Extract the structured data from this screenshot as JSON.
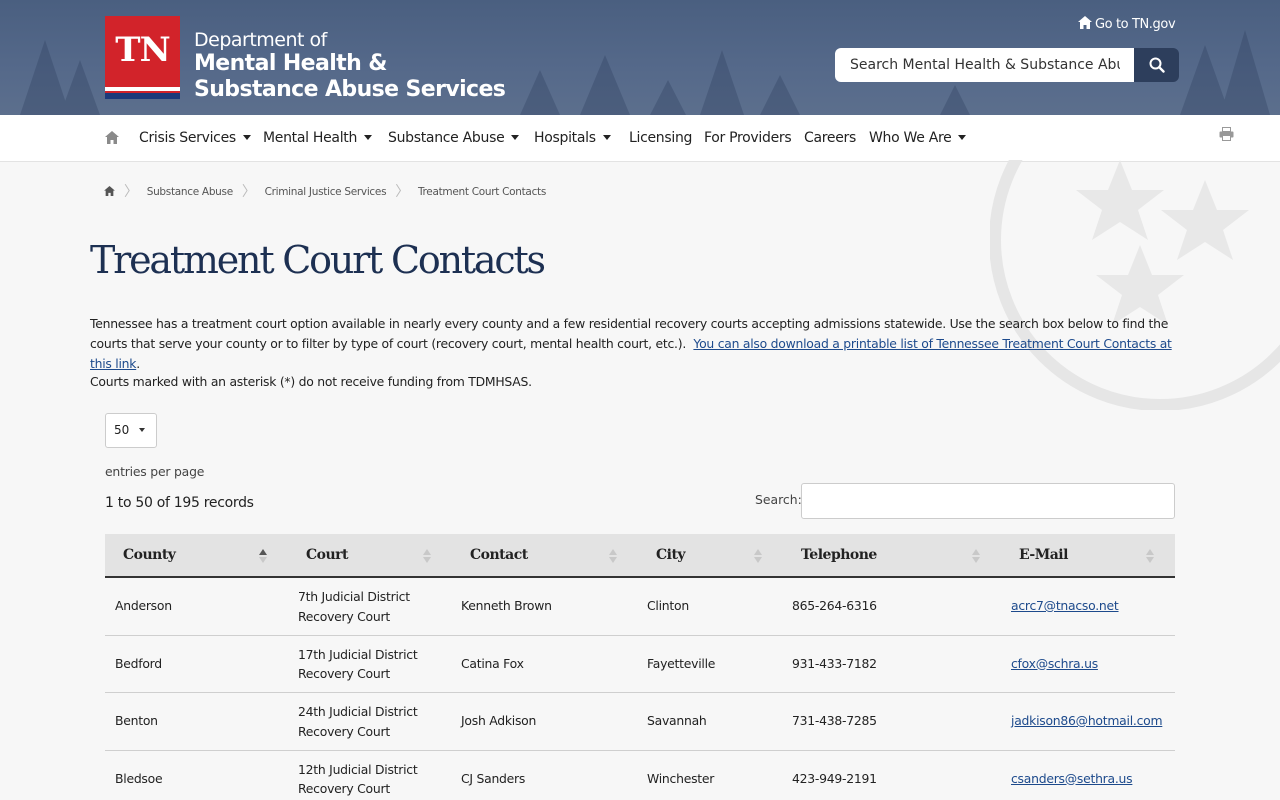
{
  "header": {
    "logo_text": "TN",
    "dept_line1": "Department of",
    "dept_line2": "Mental Health &",
    "dept_line3": "Substance Abuse Services",
    "goto_link": "Go to TN.gov",
    "search_placeholder": "Search Mental Health & Substance Abuse Services"
  },
  "nav": {
    "items": [
      {
        "label": "Crisis Services",
        "dropdown": true
      },
      {
        "label": "Mental Health",
        "dropdown": true
      },
      {
        "label": "Substance Abuse",
        "dropdown": true
      },
      {
        "label": "Hospitals",
        "dropdown": true
      },
      {
        "label": "Licensing",
        "dropdown": false
      },
      {
        "label": "For Providers",
        "dropdown": false
      },
      {
        "label": "Careers",
        "dropdown": false
      },
      {
        "label": "Who We Are",
        "dropdown": true
      }
    ]
  },
  "breadcrumb": [
    "Substance Abuse",
    "Criminal Justice Services",
    "Treatment Court Contacts"
  ],
  "page_title": "Treatment Court Contacts",
  "intro": {
    "text": "Tennessee has a treatment court option available in nearly every county and a few residential recovery courts accepting admissions statewide.  Use the search box below to find the courts that serve your county or to filter by type of court (recovery court, mental health court, etc.).",
    "link": "You can also download a printable list of Tennessee Treatment Court Contacts at this link",
    "period": "."
  },
  "note": "Courts marked with an asterisk (*) do not receive funding from TDMHSAS.",
  "table_controls": {
    "page_length": "50",
    "entries_label": "entries per page",
    "records_info": "1 to 50 of 195 records",
    "search_label": "Search:"
  },
  "table": {
    "columns": [
      "County",
      "Court",
      "Contact",
      "City",
      "Telephone",
      "E-Mail"
    ],
    "rows": [
      {
        "county": "Anderson",
        "court1": "7th Judicial District",
        "court2": "Recovery Court",
        "contact": "Kenneth Brown",
        "city": "Clinton",
        "phone": "865-264-6316",
        "email": "acrc7@tnacso.net"
      },
      {
        "county": "Bedford",
        "court1": "17th Judicial District",
        "court2": "Recovery Court",
        "contact": "Catina Fox",
        "city": "Fayetteville",
        "phone": "931-433-7182",
        "email": "cfox@schra.us"
      },
      {
        "county": "Benton",
        "court1": "24th Judicial District",
        "court2": "Recovery Court",
        "contact": "Josh Adkison",
        "city": "Savannah",
        "phone": "731-438-7285",
        "email": "jadkison86@hotmail.com"
      },
      {
        "county": "Bledsoe",
        "court1": "12th Judicial District",
        "court2": "Recovery Court",
        "contact": "CJ Sanders",
        "city": "Winchester",
        "phone": "423-949-2191",
        "email": "csanders@sethra.us"
      }
    ]
  },
  "colors": {
    "header_bg": "#4a5f80",
    "logo_red": "#d2232a",
    "title_navy": "#1d3052",
    "link_blue": "#1d4a8c"
  }
}
